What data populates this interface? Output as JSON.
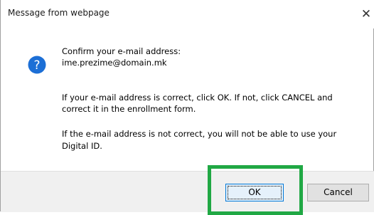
{
  "window": {
    "title": "Message from webpage",
    "close_glyph": "✕"
  },
  "icon": {
    "name": "question-icon",
    "glyph": "?",
    "color": "#1c6fd6"
  },
  "message": {
    "line1": "Confirm your e-mail address:",
    "line2": "ime.prezime@domain.mk",
    "line3": "If your e-mail address is correct, click OK. If not, click CANCEL and",
    "line4": "correct it in the enrollment form.",
    "line5": "If the e-mail address is not correct, you will not be able to use your",
    "line6": "Digital ID."
  },
  "buttons": {
    "ok_label": "OK",
    "cancel_label": "Cancel"
  },
  "colors": {
    "highlight": "#20a844",
    "ok_border": "#0078d7"
  }
}
